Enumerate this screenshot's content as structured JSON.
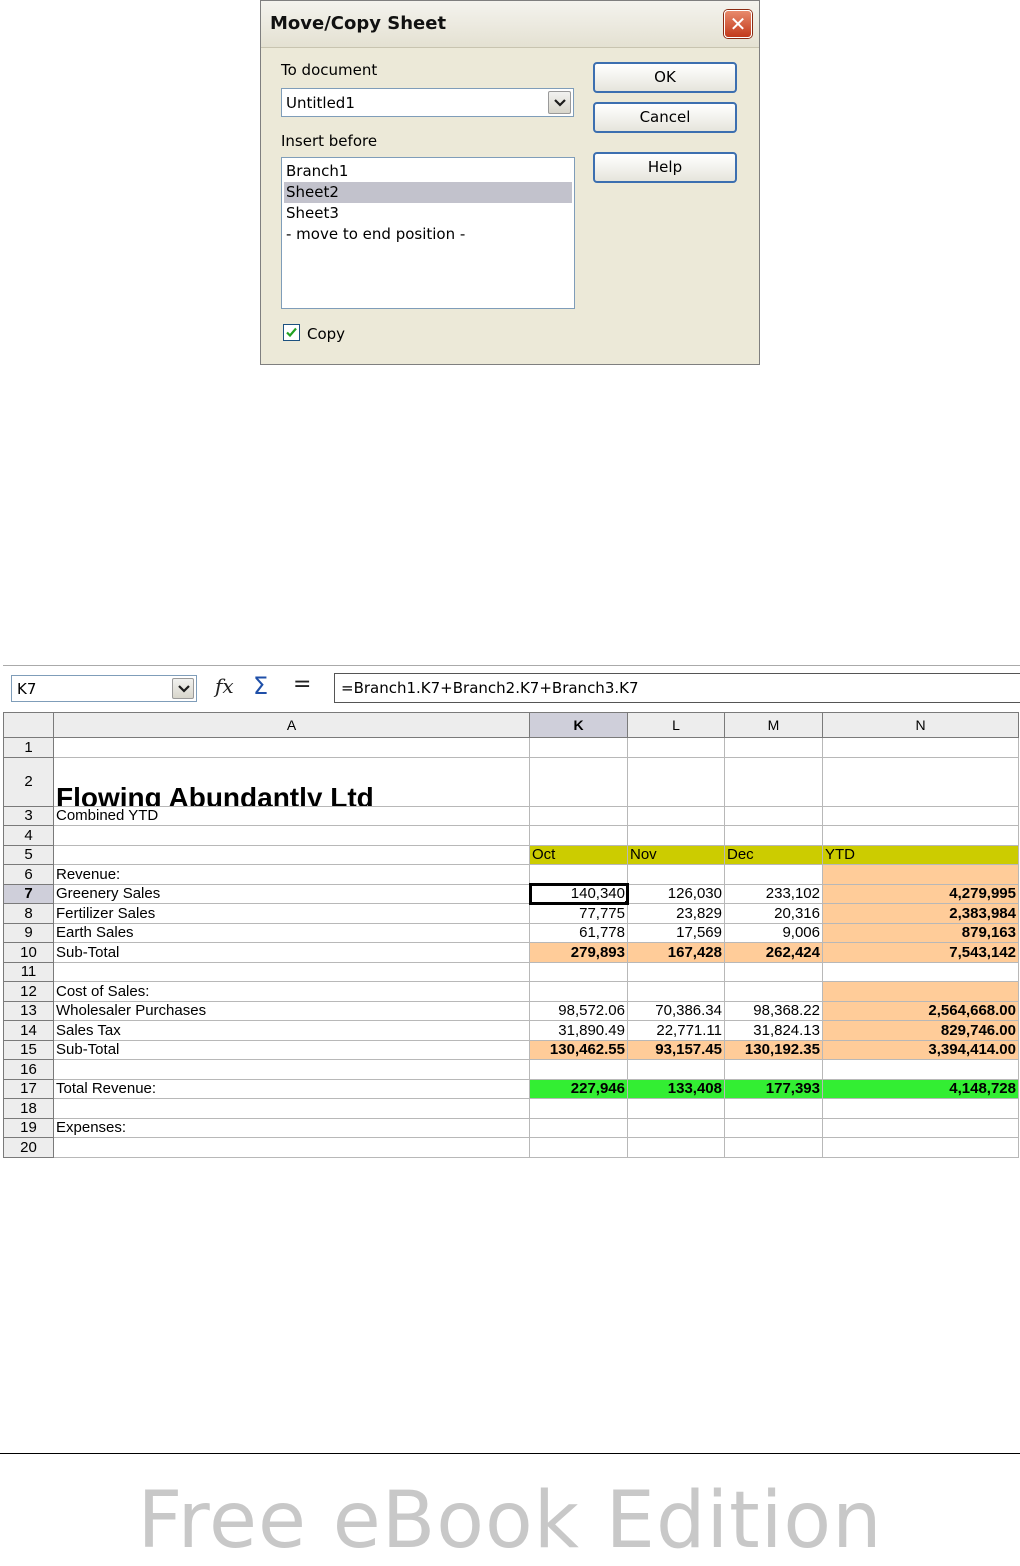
{
  "dialog": {
    "title": "Move/Copy Sheet",
    "close_glyph": "✕",
    "to_document_label": "To document",
    "to_document_value": "Untitled1",
    "insert_before_label": "Insert before",
    "list_items": [
      "Branch1",
      "Sheet2",
      "Sheet3",
      "- move to end position -"
    ],
    "selected_item": "Sheet2",
    "ok_label": "OK",
    "cancel_label": "Cancel",
    "help_label": "Help",
    "copy_label": "Copy",
    "copy_checked": true
  },
  "spreadsheet": {
    "name_box": "K7",
    "formula": "=Branch1.K7+Branch2.K7+Branch3.K7",
    "icons": {
      "function_wizard": "fx",
      "sum": "Σ",
      "equals": "="
    },
    "column_headers": [
      "A",
      "K",
      "L",
      "M",
      "N"
    ],
    "active_column": "K",
    "active_row": "7",
    "rows": [
      {
        "n": "1",
        "A": "",
        "K": "",
        "L": "",
        "M": "",
        "N": ""
      },
      {
        "n": "2",
        "A": "Flowing Abundantly Ltd",
        "K": "",
        "L": "",
        "M": "",
        "N": ""
      },
      {
        "n": "3",
        "A": "Combined YTD",
        "K": "",
        "L": "",
        "M": "",
        "N": ""
      },
      {
        "n": "4",
        "A": "",
        "K": "",
        "L": "",
        "M": "",
        "N": ""
      },
      {
        "n": "5",
        "A": "",
        "K": "Oct",
        "L": "Nov",
        "M": "Dec",
        "N": "YTD"
      },
      {
        "n": "6",
        "A": "Revenue:",
        "K": "",
        "L": "",
        "M": "",
        "N": ""
      },
      {
        "n": "7",
        "A": "Greenery Sales",
        "K": "140,340",
        "L": "126,030",
        "M": "233,102",
        "N": "4,279,995"
      },
      {
        "n": "8",
        "A": "Fertilizer Sales",
        "K": "77,775",
        "L": "23,829",
        "M": "20,316",
        "N": "2,383,984"
      },
      {
        "n": "9",
        "A": "Earth Sales",
        "K": "61,778",
        "L": "17,569",
        "M": "9,006",
        "N": "879,163"
      },
      {
        "n": "10",
        "A": "Sub-Total",
        "K": "279,893",
        "L": "167,428",
        "M": "262,424",
        "N": "7,543,142"
      },
      {
        "n": "11",
        "A": "",
        "K": "",
        "L": "",
        "M": "",
        "N": ""
      },
      {
        "n": "12",
        "A": "Cost of Sales:",
        "K": "",
        "L": "",
        "M": "",
        "N": ""
      },
      {
        "n": "13",
        "A": "Wholesaler Purchases",
        "K": "98,572.06",
        "L": "70,386.34",
        "M": "98,368.22",
        "N": "2,564,668.00"
      },
      {
        "n": "14",
        "A": "Sales Tax",
        "K": "31,890.49",
        "L": "22,771.11",
        "M": "31,824.13",
        "N": "829,746.00"
      },
      {
        "n": "15",
        "A": "Sub-Total",
        "K": "130,462.55",
        "L": "93,157.45",
        "M": "130,192.35",
        "N": "3,394,414.00"
      },
      {
        "n": "16",
        "A": "",
        "K": "",
        "L": "",
        "M": "",
        "N": ""
      },
      {
        "n": "17",
        "A": "Total Revenue:",
        "K": "227,946",
        "L": "133,408",
        "M": "177,393",
        "N": "4,148,728"
      },
      {
        "n": "18",
        "A": "",
        "K": "",
        "L": "",
        "M": "",
        "N": ""
      },
      {
        "n": "19",
        "A": "Expenses:",
        "K": "",
        "L": "",
        "M": "",
        "N": ""
      },
      {
        "n": "20",
        "A": "",
        "K": "",
        "L": "",
        "M": "",
        "N": ""
      }
    ],
    "colors": {
      "header_fill": "#cccc00",
      "subtotal_fill": "#ffcc99",
      "total_fill": "#33ee33"
    }
  },
  "footer": {
    "text": "Free eBook Edition"
  }
}
